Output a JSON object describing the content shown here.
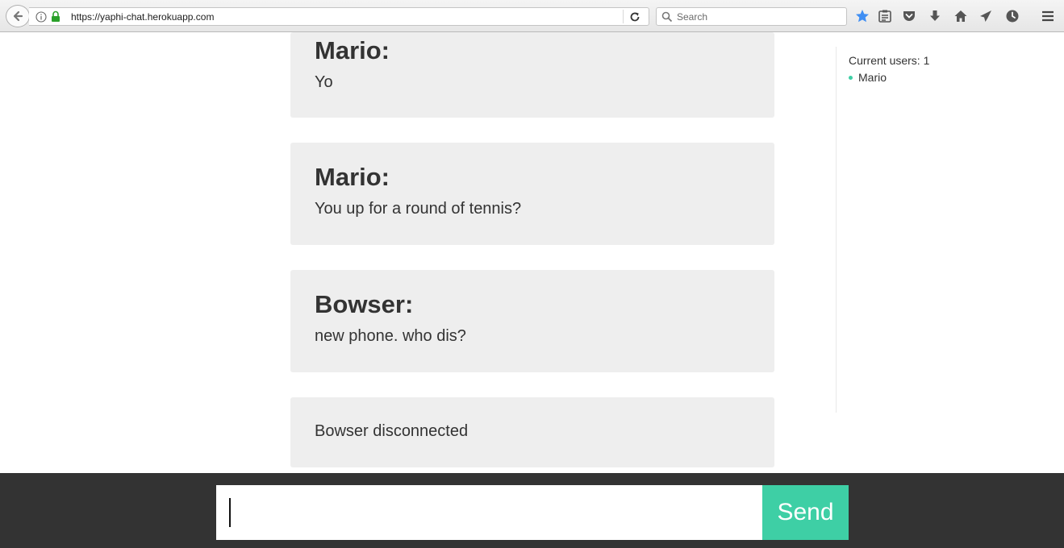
{
  "browser": {
    "url": "https://yaphi-chat.herokuapp.com",
    "search_placeholder": "Search",
    "accent_color": "#3f8ef3"
  },
  "messages": [
    {
      "user": "Mario:",
      "text": "Yo"
    },
    {
      "user": "Mario:",
      "text": "You up for a round of tennis?"
    },
    {
      "user": "Bowser:",
      "text": "new phone. who dis?"
    },
    {
      "user": "",
      "text": "Bowser disconnected"
    }
  ],
  "sidebar": {
    "count_label": "Current users: 1",
    "users": [
      "Mario"
    ]
  },
  "composer": {
    "value": "",
    "send_label": "Send",
    "accent_color": "#3ecfa5"
  }
}
